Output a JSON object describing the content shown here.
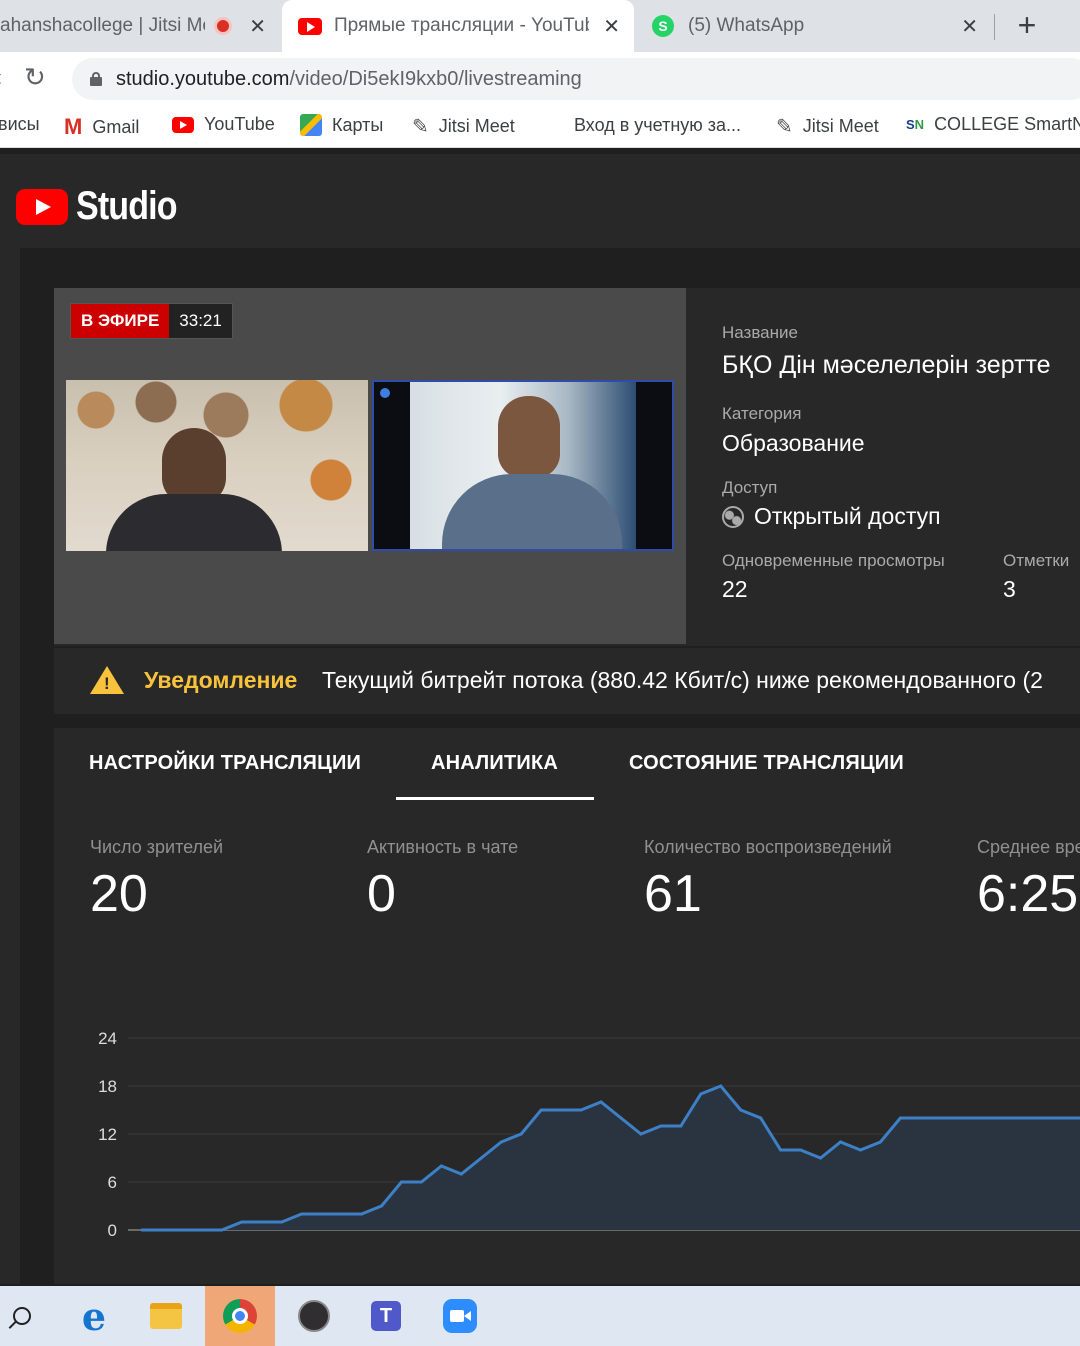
{
  "browser": {
    "tabs": [
      {
        "title": "ahanshacollege | Jitsi Mee",
        "active": false
      },
      {
        "title": "Прямые трансляции - YouTube",
        "active": true
      },
      {
        "title": "(5) WhatsApp",
        "active": false
      }
    ],
    "url": {
      "host": "studio.youtube.com",
      "path": "/video/Di5ekI9kxb0/livestreaming"
    },
    "bookmarks": [
      {
        "label": "висы"
      },
      {
        "label": "Gmail",
        "icon": "gmail-icon"
      },
      {
        "label": "YouTube",
        "icon": "youtube-icon"
      },
      {
        "label": "Карты",
        "icon": "maps-icon"
      },
      {
        "label": "Jitsi Meet",
        "icon": "jitsi-icon"
      },
      {
        "label": "Вход в учетную за...",
        "icon": "microsoft-icon"
      },
      {
        "label": "Jitsi Meet",
        "icon": "jitsi-icon"
      },
      {
        "label": "COLLEGE SmartN",
        "icon": "smartnation-icon"
      }
    ]
  },
  "studio": {
    "logo_text": "Studio",
    "live_badge": "В ЭФИРЕ",
    "live_time": "33:21",
    "info": {
      "title_label": "Название",
      "title_value": "БҚО Дін мәселелерін зертте",
      "category_label": "Категория",
      "category_value": "Образование",
      "access_label": "Доступ",
      "access_value": "Открытый доступ",
      "concurrent_label": "Одновременные просмотры",
      "concurrent_value": "22",
      "likes_label": "Отметки",
      "likes_value": "3"
    },
    "notice": {
      "label": "Уведомление",
      "text": "Текущий битрейт потока (880.42 Кбит/с) ниже рекомендованного (2"
    },
    "tabs": [
      "НАСТРОЙКИ ТРАНСЛЯЦИИ",
      "АНАЛИТИКА",
      "СОСТОЯНИЕ ТРАНСЛЯЦИИ"
    ],
    "active_tab": 1,
    "metrics": [
      {
        "label": "Число зрителей",
        "value": "20"
      },
      {
        "label": "Активность в чате",
        "value": "0"
      },
      {
        "label": "Количество воспроизведений",
        "value": "61"
      },
      {
        "label": "Среднее вре",
        "value": "6:25"
      }
    ]
  },
  "colors": {
    "accent": "#3ea6ff",
    "live": "#cc0000",
    "warning": "#f9c23c",
    "chart_line": "#3d80c6"
  },
  "chart_data": {
    "type": "area",
    "yticks": [
      0,
      6,
      12,
      18,
      24
    ],
    "ylim": [
      0,
      24
    ],
    "grid": true,
    "x": [
      0,
      1,
      2,
      3,
      4,
      5,
      6,
      7,
      8,
      9,
      10,
      11,
      12,
      13,
      14,
      15,
      16,
      17,
      18,
      19,
      20,
      21,
      22,
      23,
      24,
      25,
      26,
      27,
      28,
      29,
      30,
      31,
      32,
      33,
      34,
      35,
      36,
      37,
      38,
      39,
      40,
      41,
      42,
      43,
      44,
      45,
      46,
      47
    ],
    "values": [
      0,
      0,
      0,
      0,
      0,
      1,
      1,
      1,
      2,
      2,
      2,
      2,
      3,
      6,
      6,
      8,
      7,
      9,
      11,
      12,
      15,
      15,
      15,
      16,
      14,
      12,
      13,
      13,
      17,
      18,
      15,
      14,
      10,
      10,
      9,
      11,
      10,
      11,
      14,
      14,
      14,
      14,
      14,
      14,
      14,
      14,
      14,
      14
    ]
  },
  "taskbar": {
    "icons": [
      "search-icon",
      "edge-icon",
      "file-explorer-icon",
      "chrome-icon",
      "obs-icon",
      "teams-icon",
      "zoom-icon"
    ]
  }
}
